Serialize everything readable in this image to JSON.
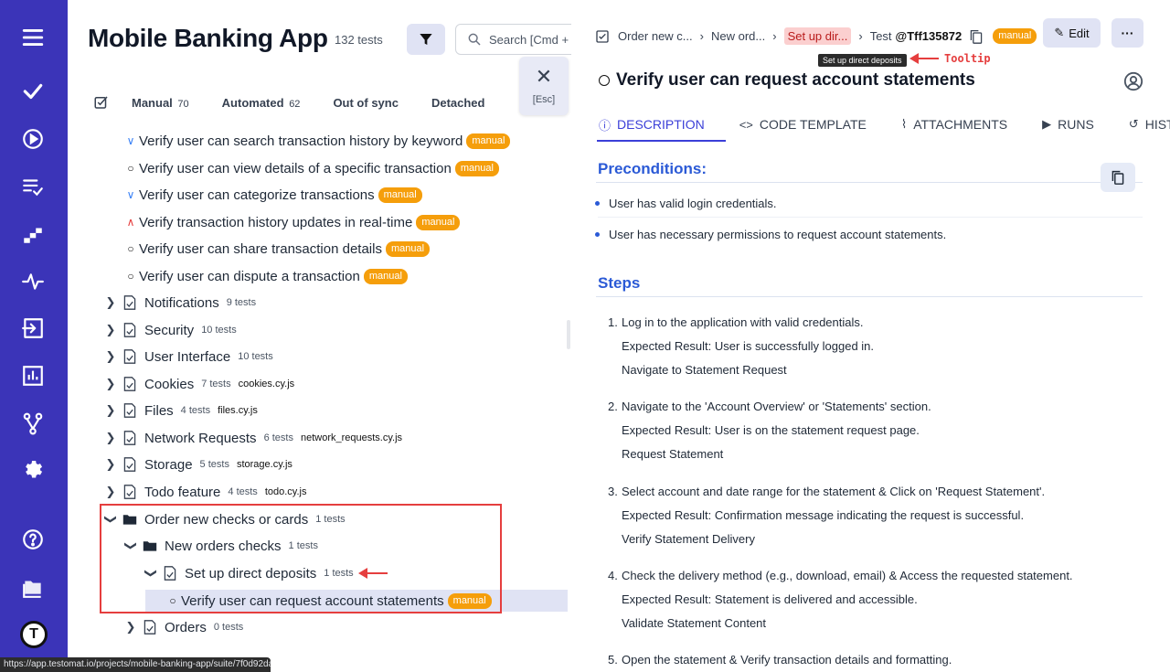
{
  "rail": {
    "icons": [
      "menu-icon",
      "checkmark-icon",
      "play-icon",
      "list-check-icon",
      "stairs-icon",
      "pulse-icon",
      "import-icon",
      "analytics-icon",
      "branch-icon",
      "settings-icon",
      "help-icon",
      "folder-icon"
    ],
    "logo": "T"
  },
  "project": {
    "title": "Mobile Banking App",
    "count": "132 tests",
    "search_placeholder": "Search [Cmd +",
    "esc_label": "[Esc]"
  },
  "tabs": [
    {
      "label": "Manual",
      "count": "70"
    },
    {
      "label": "Automated",
      "count": "62"
    },
    {
      "label": "Out of sync",
      "count": ""
    },
    {
      "label": "Detached",
      "count": ""
    }
  ],
  "tree": {
    "tests": [
      {
        "status": "∨",
        "label": "Verify user can search transaction history by keyword",
        "badge": "manual"
      },
      {
        "status": "○",
        "label": "Verify user can view details of a specific transaction",
        "badge": "manual"
      },
      {
        "status": "∨",
        "label": "Verify user can categorize transactions",
        "badge": "manual"
      },
      {
        "status": "∧",
        "label": "Verify transaction history updates in real-time",
        "badge": "manual"
      },
      {
        "status": "○",
        "label": "Verify user can share transaction details",
        "badge": "manual"
      },
      {
        "status": "○",
        "label": "Verify user can dispute a transaction",
        "badge": "manual"
      }
    ],
    "suites": [
      {
        "label": "Notifications",
        "count": "9 tests",
        "file": ""
      },
      {
        "label": "Security",
        "count": "10 tests",
        "file": ""
      },
      {
        "label": "User Interface",
        "count": "10 tests",
        "file": ""
      },
      {
        "label": "Cookies",
        "count": "7 tests",
        "file": "cookies.cy.js"
      },
      {
        "label": "Files",
        "count": "4 tests",
        "file": "files.cy.js"
      },
      {
        "label": "Network Requests",
        "count": "6 tests",
        "file": "network_requests.cy.js"
      },
      {
        "label": "Storage",
        "count": "5 tests",
        "file": "storage.cy.js"
      },
      {
        "label": "Todo feature",
        "count": "4 tests",
        "file": "todo.cy.js"
      }
    ],
    "order_folder": {
      "label": "Order new checks or cards",
      "count": "1 tests"
    },
    "new_orders_folder": {
      "label": "New orders checks",
      "count": "1 tests"
    },
    "direct_deposits": {
      "label": "Set up direct deposits",
      "count": "1 tests"
    },
    "selected_test": {
      "label": "Verify user can request account statements",
      "badge": "manual"
    },
    "orders": {
      "label": "Orders",
      "count": "0 tests"
    }
  },
  "statusbar": "https://app.testomat.io/projects/mobile-banking-app/suite/7f0d92da",
  "detail": {
    "crumbs": [
      "Order new c...",
      "New ord...",
      "Set up dir...",
      "Test"
    ],
    "test_id": "@Tff135872",
    "badge": "manual",
    "edit_label": "Edit",
    "more_label": "···",
    "tooltip": "Set up direct deposits",
    "tooltip_note": "Tooltip",
    "title": "Verify user can request account statements",
    "tabs": [
      "DESCRIPTION",
      "CODE TEMPLATE",
      "ATTACHMENTS",
      "RUNS",
      "HIST"
    ],
    "preconditions_heading": "Preconditions:",
    "preconditions": [
      "User has valid login credentials.",
      "User has necessary permissions to request account statements."
    ],
    "steps_heading": "Steps",
    "steps": [
      {
        "num": "1.",
        "action": "Log in to the application with valid credentials.",
        "expected": "Expected Result: User is successfully logged in.",
        "next": "Navigate to Statement Request"
      },
      {
        "num": "2.",
        "action": "Navigate to the 'Account Overview' or 'Statements' section.",
        "expected": "Expected Result: User is on the statement request page.",
        "next": "Request Statement"
      },
      {
        "num": "3.",
        "action": "Select account and date range for the statement & Click on 'Request Statement'.",
        "expected": "Expected Result: Confirmation message indicating the request is successful.",
        "next": "Verify Statement Delivery"
      },
      {
        "num": "4.",
        "action": "Check the delivery method (e.g., download, email) & Access the requested statement.",
        "expected": "Expected Result: Statement is delivered and accessible.",
        "next": "Validate Statement Content"
      },
      {
        "num": "5.",
        "action": "Open the statement & Verify transaction details and formatting.",
        "expected": "",
        "next": ""
      }
    ]
  },
  "colors": {
    "rail": "#3b34b8",
    "accent": "#3b3fd8",
    "badge": "#f59e0b",
    "annotation": "#e53e3e",
    "heading": "#2b5ad6"
  }
}
